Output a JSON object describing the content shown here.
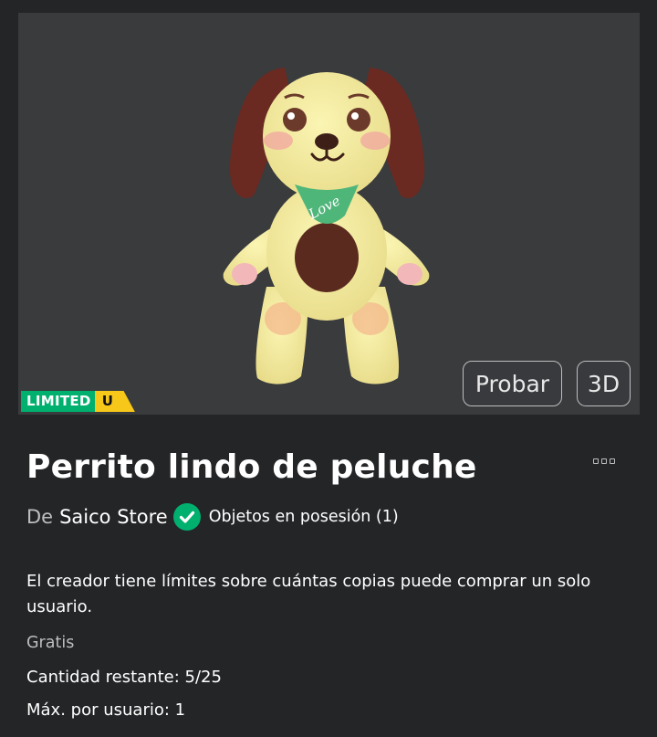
{
  "item": {
    "limited_label": "LIMITED",
    "limited_badge": "U",
    "title": "Perrito lindo de peluche",
    "preview_image": "plush-dog-accessory-3d-preview",
    "preview_text": "Love"
  },
  "viewer": {
    "try_label": "Probar",
    "three_d_label": "3D"
  },
  "creator": {
    "prefix": "De",
    "name": "Saico Store",
    "verified_icon": "verified-check-icon",
    "owned_label": "Objetos en posesión (1)"
  },
  "details": {
    "description": "El creador tiene límites sobre cuántas copias puede comprar un solo usuario.",
    "price": "Gratis",
    "remaining": "Cantidad restante: 5/25",
    "max_per_user": "Máx. por usuario: 1"
  },
  "menu": {
    "icon": "more-options-icon"
  },
  "colors": {
    "background": "#232527",
    "viewer_bg": "#393b3d",
    "limited_green": "#00b06f",
    "limited_yellow": "#f7c719",
    "verified_green": "#00b06f",
    "muted_text": "#bdbebe"
  }
}
